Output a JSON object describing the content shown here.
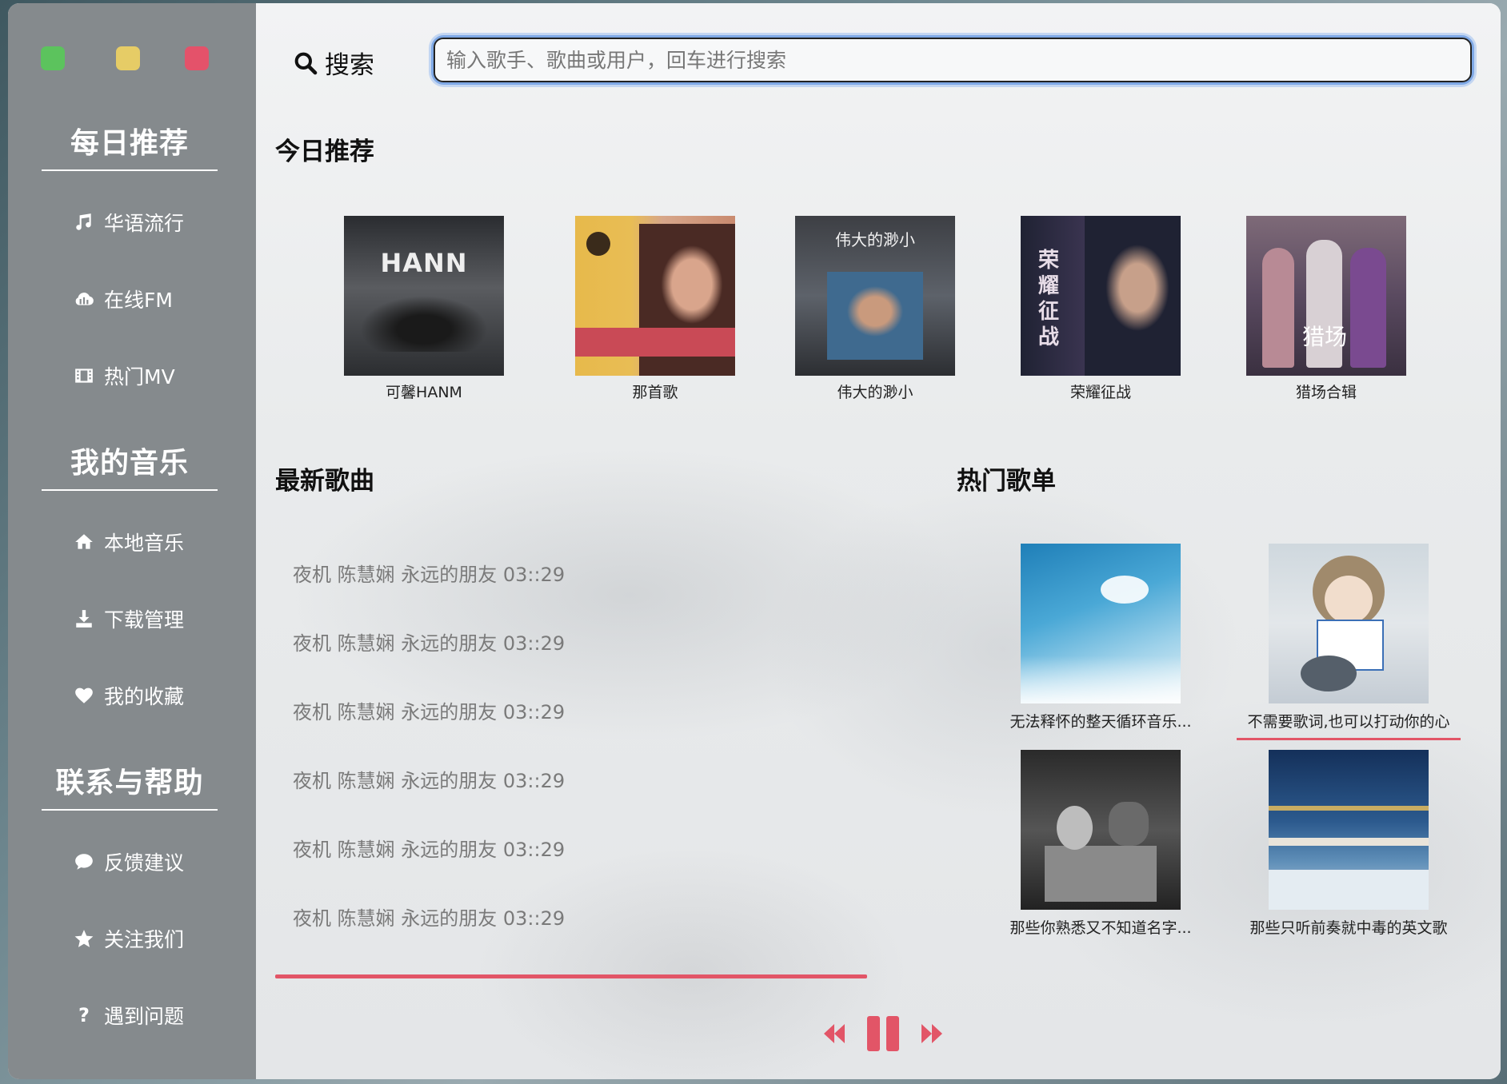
{
  "window": {
    "controls": [
      "green",
      "yellow",
      "red"
    ]
  },
  "sidebar": {
    "sections": [
      {
        "title": "每日推荐",
        "items": [
          {
            "label": "华语流行",
            "icon": "music-note-icon"
          },
          {
            "label": "在线FM",
            "icon": "cloud-icon"
          },
          {
            "label": "热门MV",
            "icon": "film-icon"
          }
        ]
      },
      {
        "title": "我的音乐",
        "items": [
          {
            "label": "本地音乐",
            "icon": "home-icon"
          },
          {
            "label": "下载管理",
            "icon": "download-icon"
          },
          {
            "label": "我的收藏",
            "icon": "heart-icon"
          }
        ]
      },
      {
        "title": "联系与帮助",
        "items": [
          {
            "label": "反馈建议",
            "icon": "comment-icon"
          },
          {
            "label": "关注我们",
            "icon": "star-icon"
          },
          {
            "label": "遇到问题",
            "icon": "question-icon"
          }
        ]
      }
    ]
  },
  "search": {
    "label": "搜索",
    "placeholder": "输入歌手、歌曲或用户，回车进行搜索",
    "value": ""
  },
  "today": {
    "title": "今日推荐",
    "albums": [
      {
        "title": "可馨HANM",
        "cover_text": "HANN"
      },
      {
        "title": "那首歌",
        "cover_text": ""
      },
      {
        "title": "伟大的渺小",
        "cover_text": "伟大的渺小"
      },
      {
        "title": "荣耀征战",
        "cover_text": "荣耀征战"
      },
      {
        "title": "猎场合辑",
        "cover_text": "猎场"
      }
    ]
  },
  "new_songs": {
    "title": "最新歌曲",
    "items": [
      "夜机 陈慧娴 永远的朋友 03::29",
      "夜机 陈慧娴 永远的朋友 03::29",
      "夜机 陈慧娴 永远的朋友 03::29",
      "夜机 陈慧娴 永远的朋友 03::29",
      "夜机 陈慧娴 永远的朋友 03::29",
      "夜机 陈慧娴 永远的朋友 03::29"
    ]
  },
  "hot_playlists": {
    "title": "热门歌单",
    "items": [
      {
        "title": "无法释怀的整天循环音乐..."
      },
      {
        "title": "不需要歌词,也可以打动你的心"
      },
      {
        "title": "那些你熟悉又不知道名字..."
      },
      {
        "title": "那些只听前奏就中毒的英文歌"
      }
    ]
  },
  "colors": {
    "accent": "#e25567",
    "sidebar": "#858a8d",
    "search_focus": "#7fa9e6"
  }
}
